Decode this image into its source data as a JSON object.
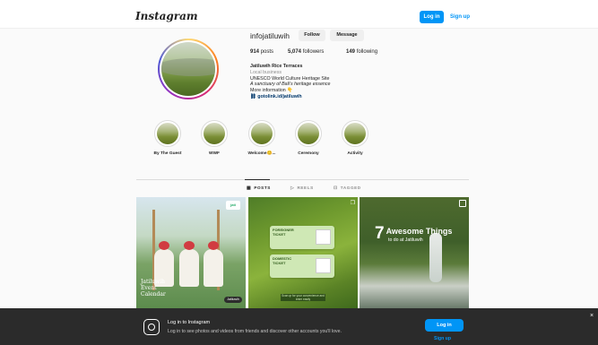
{
  "header": {
    "logo": "Instagram",
    "login_label": "Log in",
    "signup_label": "Sign up"
  },
  "profile": {
    "username": "infojatiluwih",
    "follow_label": "Follow",
    "message_label": "Message",
    "stats": {
      "posts": "914",
      "posts_label": "posts",
      "followers": "5,074",
      "followers_label": "followers",
      "following": "149",
      "following_label": "following"
    },
    "bio": {
      "name": "Jatiluwih Rice Terraces",
      "category": "Local business",
      "line1": "UNESCO World Culture Heritage Site",
      "line2": "A sanctuary of Bali's heritage essence",
      "line3": "More information 👇",
      "link": "gotolink.id/jatiluwih"
    }
  },
  "highlights": [
    {
      "label": "By The Guest"
    },
    {
      "label": "WWF"
    },
    {
      "label": "Welcome😊..."
    },
    {
      "label": "Ceremony"
    },
    {
      "label": "Activity"
    }
  ],
  "tabs": [
    {
      "label": "POSTS",
      "active": true
    },
    {
      "label": "REELS",
      "active": false
    },
    {
      "label": "TAGGED",
      "active": false
    }
  ],
  "posts": {
    "p1": {
      "title_l1": "Jatiluwih",
      "title_l2": "Event",
      "title_l3": "Calendar",
      "badge": "jati",
      "bottle": "Jatiluwih"
    },
    "p2": {
      "ticket1": "FOREIGNER\nTICKET",
      "ticket2": "DOMESTIC\nTICKET",
      "caption": "Scan qr for your convenience and enter easily"
    },
    "p3": {
      "number": "7",
      "title": "Awesome Things",
      "subtitle": "to do at Jatiluwih"
    }
  },
  "banner": {
    "title": "Log in to Instagram",
    "description": "Log in to see photos and videos from friends and discover other accounts you'll love.",
    "login_label": "Log in",
    "signup_label": "Sign up",
    "close": "×"
  }
}
